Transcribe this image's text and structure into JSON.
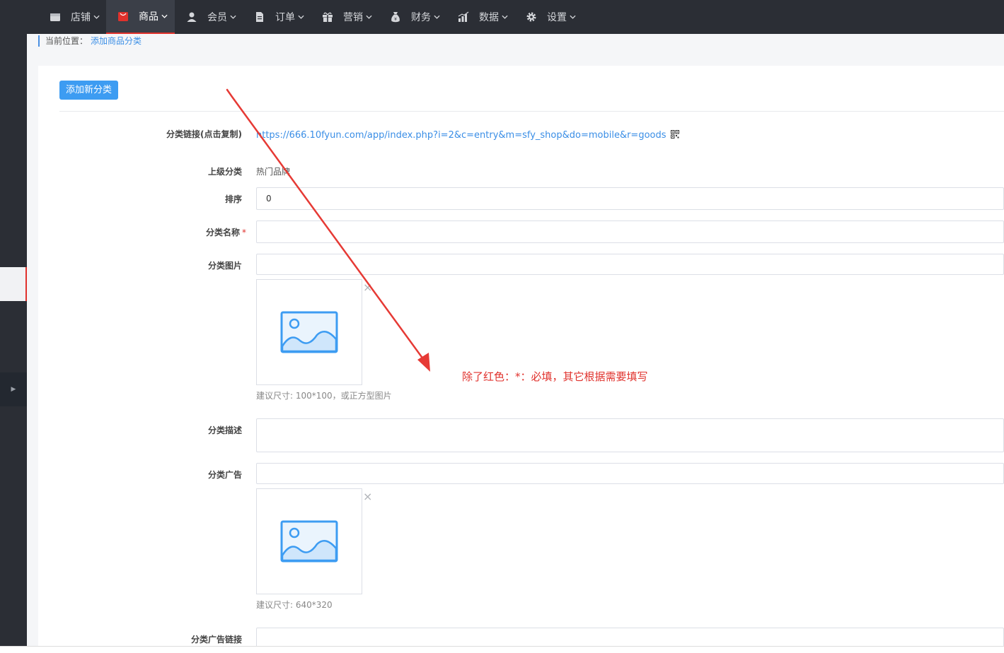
{
  "nav": {
    "items": [
      {
        "label": "店铺",
        "icon": "store-icon",
        "active": false
      },
      {
        "label": "商品",
        "icon": "goods-icon",
        "active": true
      },
      {
        "label": "会员",
        "icon": "user-icon",
        "active": false
      },
      {
        "label": "订单",
        "icon": "order-icon",
        "active": false
      },
      {
        "label": "营销",
        "icon": "gift-icon",
        "active": false
      },
      {
        "label": "财务",
        "icon": "money-bag-icon",
        "active": false
      },
      {
        "label": "数据",
        "icon": "bar-chart-icon",
        "active": false
      },
      {
        "label": "设置",
        "icon": "gear-icon",
        "active": false
      }
    ],
    "active_color": "#e0312c"
  },
  "breadcrumb": {
    "prefix": "当前位置：",
    "current": "添加商品分类"
  },
  "toolbar": {
    "add_button": "添加新分类"
  },
  "form": {
    "link": {
      "label": "分类链接(点击复制)",
      "value": "https://666.10fyun.com/app/index.php?i=2&c=entry&m=sfy_shop&do=mobile&r=goods"
    },
    "parent": {
      "label": "上级分类",
      "value": "热门品牌"
    },
    "sort": {
      "label": "排序",
      "value": "0"
    },
    "name": {
      "label": "分类名称",
      "required_mark": "*",
      "value": ""
    },
    "image": {
      "label": "分类图片",
      "value": "",
      "remove": "×",
      "hint": "建议尺寸: 100*100，或正方型图片"
    },
    "description": {
      "label": "分类描述",
      "value": ""
    },
    "ad": {
      "label": "分类广告",
      "value": "",
      "remove": "×",
      "hint": "建议尺寸: 640*320"
    },
    "ad_link": {
      "label": "分类广告链接"
    }
  },
  "annotation": {
    "text": "除了红色：*：必填，其它根据需要填写",
    "color": "#e0312c"
  },
  "colors": {
    "accent": "#3d9cf2",
    "link": "#3a8ee6",
    "topbar": "#2b2e35"
  }
}
